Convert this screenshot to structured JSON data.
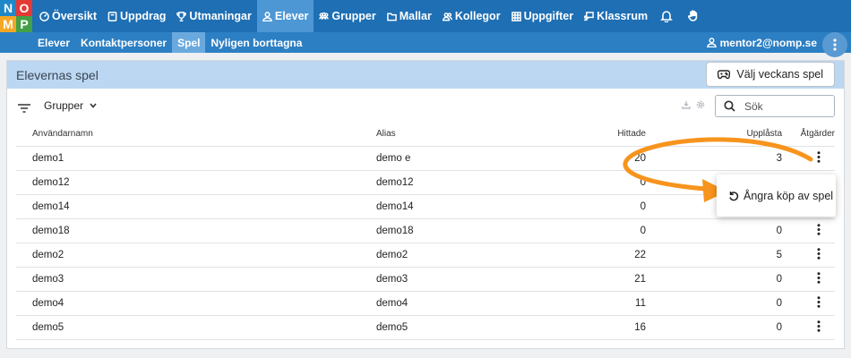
{
  "logo": {
    "letters": [
      "N",
      "O",
      "M",
      "P"
    ]
  },
  "nav": {
    "items": [
      {
        "label": "Översikt",
        "icon": "speedometer-icon"
      },
      {
        "label": "Uppdrag",
        "icon": "book-icon"
      },
      {
        "label": "Utmaningar",
        "icon": "trophy-icon"
      },
      {
        "label": "Elever",
        "icon": "person-icon",
        "active": true
      },
      {
        "label": "Grupper",
        "icon": "group-icon"
      },
      {
        "label": "Mallar",
        "icon": "folder-icon"
      },
      {
        "label": "Kollegor",
        "icon": "people-icon"
      },
      {
        "label": "Uppgifter",
        "icon": "grid-icon"
      },
      {
        "label": "Klassrum",
        "icon": "presentation-icon"
      }
    ],
    "icons_right": [
      "bell-icon",
      "hand-icon"
    ]
  },
  "subnav": {
    "items": [
      {
        "label": "Elever"
      },
      {
        "label": "Kontaktpersoner"
      },
      {
        "label": "Spel",
        "active": true
      },
      {
        "label": "Nyligen borttagna"
      }
    ],
    "user": "mentor2@nomp.se"
  },
  "panel": {
    "title": "Elevernas spel",
    "weekly_button": "Välj veckans spel",
    "groups_label": "Grupper",
    "search_placeholder": "Sök"
  },
  "table": {
    "headers": [
      "Användarnamn",
      "Alias",
      "Hittade",
      "Upplåsta",
      "Åtgärder"
    ],
    "rows": [
      {
        "user": "demo1",
        "alias": "demo e",
        "found": "20",
        "unlocked": "3"
      },
      {
        "user": "demo12",
        "alias": "demo12",
        "found": "0",
        "unlocked": ""
      },
      {
        "user": "demo14",
        "alias": "demo14",
        "found": "0",
        "unlocked": ""
      },
      {
        "user": "demo18",
        "alias": "demo18",
        "found": "0",
        "unlocked": "0"
      },
      {
        "user": "demo2",
        "alias": "demo2",
        "found": "22",
        "unlocked": "5"
      },
      {
        "user": "demo3",
        "alias": "demo3",
        "found": "21",
        "unlocked": "0"
      },
      {
        "user": "demo4",
        "alias": "demo4",
        "found": "11",
        "unlocked": "0"
      },
      {
        "user": "demo5",
        "alias": "demo5",
        "found": "16",
        "unlocked": "0"
      }
    ]
  },
  "context_menu": {
    "label": "Ångra köp av spel",
    "icon": "undo-icon"
  },
  "colors": {
    "topbar": "#1e6fb4",
    "subbar": "#2d7fc3",
    "panel_header": "#bcd7f2",
    "annotation_arrow": "#f7941d"
  }
}
